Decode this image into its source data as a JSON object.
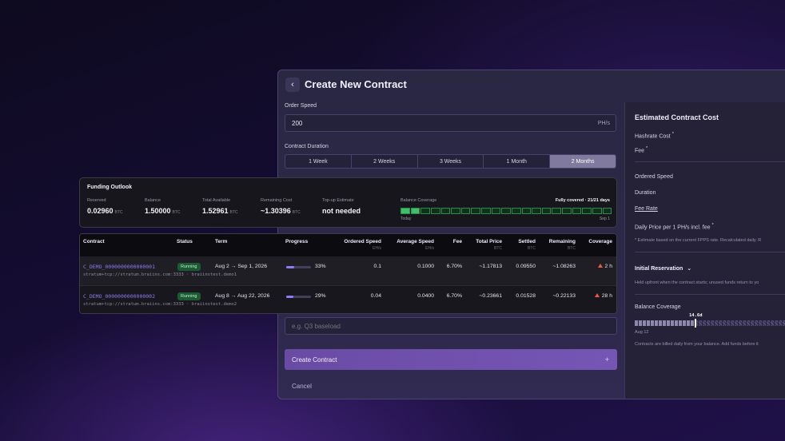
{
  "window": {
    "title": "Create New Contract",
    "back_icon": "chevron-left-icon",
    "order_speed_label": "Order Speed",
    "order_speed_value": "200",
    "order_speed_unit": "PH/s",
    "duration_label": "Contract Duration",
    "durations": [
      {
        "label": "1 Week",
        "active": false
      },
      {
        "label": "2 Weeks",
        "active": false
      },
      {
        "label": "3 Weeks",
        "active": false
      },
      {
        "label": "1 Month",
        "active": false
      },
      {
        "label": "2 Months",
        "active": true
      }
    ],
    "name_placeholder": "e.g. Q3 baseload",
    "create_label": "Create Contract",
    "create_icon": "plus-icon",
    "cancel_label": "Cancel"
  },
  "estimate": {
    "title": "Estimated Contract Cost",
    "hashrate_cost": "Hashrate Cost",
    "fee": "Fee",
    "ordered_speed": "Ordered Speed",
    "duration": "Duration",
    "fee_rate": "Fee Rate",
    "daily_price": "Daily Price per 1 PH/s incl. fee",
    "asterisk": "*",
    "note_estimate": "* Estimate based on the current FPPS rate. Recalculated daily. R",
    "initial_reservation": "Initial Reservation",
    "reservation_note": "Held upfront when the contract starts; unused funds return to yo",
    "balance_coverage": "Balance Coverage",
    "coverage_marker": "14.6d",
    "coverage_fraction": 0.35,
    "coverage_start": "Aug 12",
    "billing_note": "Contracts are billed daily from your balance. Add funds before it"
  },
  "funding": {
    "title": "Funding Outlook",
    "stats": [
      {
        "label": "Reserved",
        "value": "0.02960",
        "unit": "BTC"
      },
      {
        "label": "Balance",
        "value": "1.50000",
        "unit": "BTC"
      },
      {
        "label": "Total Available",
        "value": "1.52961",
        "unit": "BTC"
      },
      {
        "label": "Remaining Cost",
        "value": "~1.30396",
        "unit": "BTC"
      },
      {
        "label": "Top-up Estimate",
        "value": "not needed",
        "unit": ""
      }
    ],
    "coverage_label": "Balance Coverage",
    "coverage_status": "Fully covered · 21/21 days",
    "start_label": "Today",
    "end_label": "Sep 1",
    "days_covered": 21,
    "days_total": 21
  },
  "table": {
    "headers": {
      "contract": "Contract",
      "status": "Status",
      "term": "Term",
      "progress": "Progress",
      "ordered_speed": "Ordered Speed",
      "average_speed": "Average Speed",
      "fee": "Fee",
      "total_price": "Total Price",
      "settled": "Settled",
      "remaining": "Remaining",
      "coverage": "Coverage"
    },
    "units": {
      "ordered_speed": "EH/s",
      "average_speed": "EH/s",
      "total_price": "BTC",
      "settled": "BTC",
      "remaining": "BTC"
    },
    "rows": [
      {
        "id": "C_DEMO_0000000000000001",
        "pool": "stratum+tcp://stratum.braiins.com:3333 · braiinstest.demo1",
        "status": "Running",
        "term": "Aug 2 → Sep 1, 2026",
        "progress": 33,
        "progress_label": "33%",
        "ordered_speed": "0.1",
        "average_speed": "0.1000",
        "fee": "6.70%",
        "total_price": "~1.17813",
        "settled": "0.09550",
        "remaining": "~1.08263",
        "coverage": "2 h"
      },
      {
        "id": "C_DEMO_0000000000000002",
        "pool": "stratum+tcp://stratum.braiins.com:3333 · braiinstest.demo2",
        "status": "Running",
        "term": "Aug 8 → Aug 22, 2026",
        "progress": 29,
        "progress_label": "29%",
        "ordered_speed": "0.04",
        "average_speed": "0.0400",
        "fee": "6.70%",
        "total_price": "~0.23661",
        "settled": "0.01528",
        "remaining": "~0.22133",
        "coverage": "28 h"
      }
    ]
  }
}
